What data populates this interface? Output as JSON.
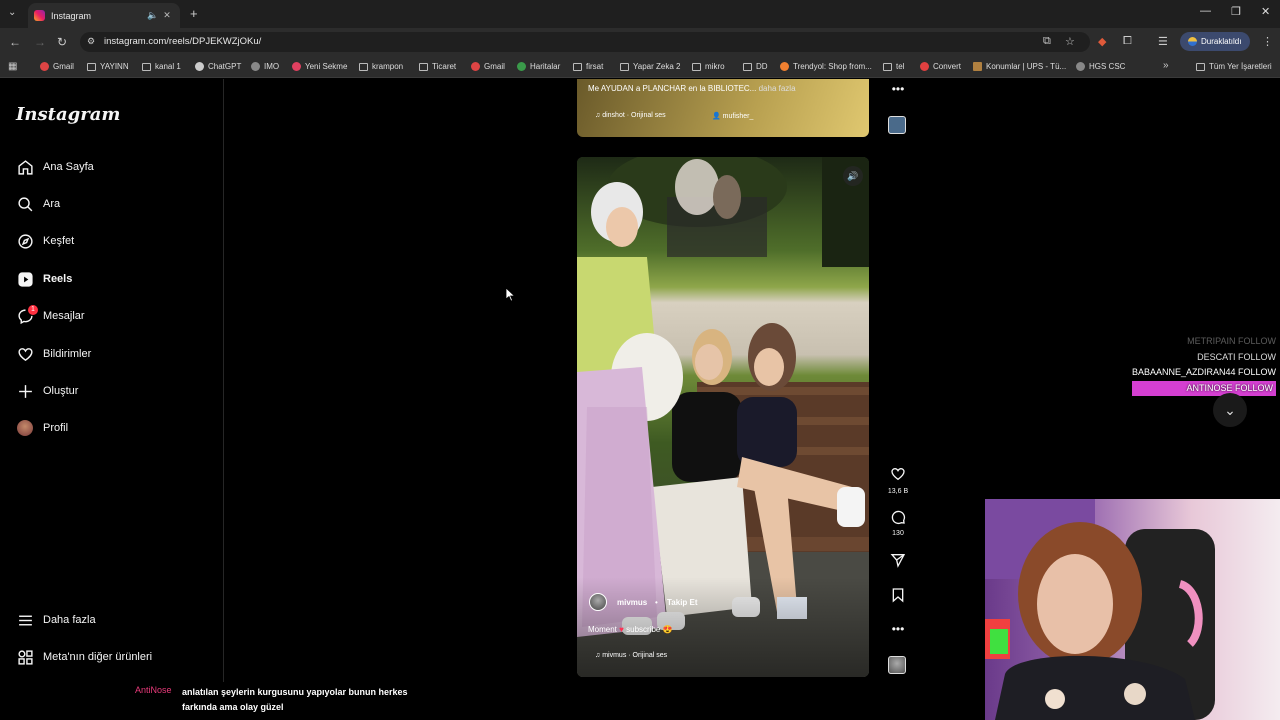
{
  "browser": {
    "tab_title": "Instagram",
    "url": "instagram.com/reels/DPJEKWZjOKu/",
    "paused_label": "Duraklatıldı",
    "bookmarks": [
      "Gmail",
      "YAYINN",
      "kanal 1",
      "ChatGPT",
      "IMO",
      "Yeni Sekme",
      "krampon",
      "Ticaret",
      "Gmail",
      "Haritalar",
      "firsat",
      "Yapar Zeka 2",
      "mikro",
      "DD",
      "Trendyol: Shop from...",
      "tel",
      "Convert",
      "Konumlar | UPS - Tü...",
      "HGS CSC"
    ],
    "all_bookmarks": "Tüm Yer İşaretleri"
  },
  "sidebar": {
    "logo": "Instagram",
    "items": [
      {
        "label": "Ana Sayfa",
        "icon": "home-icon"
      },
      {
        "label": "Ara",
        "icon": "search-icon"
      },
      {
        "label": "Keşfet",
        "icon": "compass-icon"
      },
      {
        "label": "Reels",
        "icon": "reels-icon"
      },
      {
        "label": "Mesajlar",
        "icon": "messenger-icon",
        "badge": "1"
      },
      {
        "label": "Bildirimler",
        "icon": "heart-icon"
      },
      {
        "label": "Oluştur",
        "icon": "plus-icon"
      },
      {
        "label": "Profil",
        "icon": "avatar-icon"
      }
    ],
    "more": "Daha fazla",
    "meta": "Meta'nın diğer ürünleri"
  },
  "prev_reel": {
    "caption": "Me AYUDAN a PLANCHAR en la BIBLIOTEC...",
    "more": "daha fazla",
    "audio": "dinshot · Orijinal ses",
    "tagged": "mufisher_"
  },
  "reel": {
    "username": "mivmus",
    "follow": "Takip Et",
    "caption_a": "Moment",
    "caption_b": "subscribe",
    "audio": "mivmus · Orijinal ses",
    "likes": "13,6 B",
    "comments": "130"
  },
  "stream": {
    "follows": [
      "METRIPAIN  FOLLOW",
      "DESCATI  FOLLOW",
      "BABAANNE_AZDIRAN44  FOLLOW",
      "ANTINOSE  FOLLOW"
    ],
    "chat_user": "AntiNose",
    "chat_msg": "anlatılan şeylerin kurgusunu yapıyolar bunun herkes farkında ama olay güzel"
  }
}
